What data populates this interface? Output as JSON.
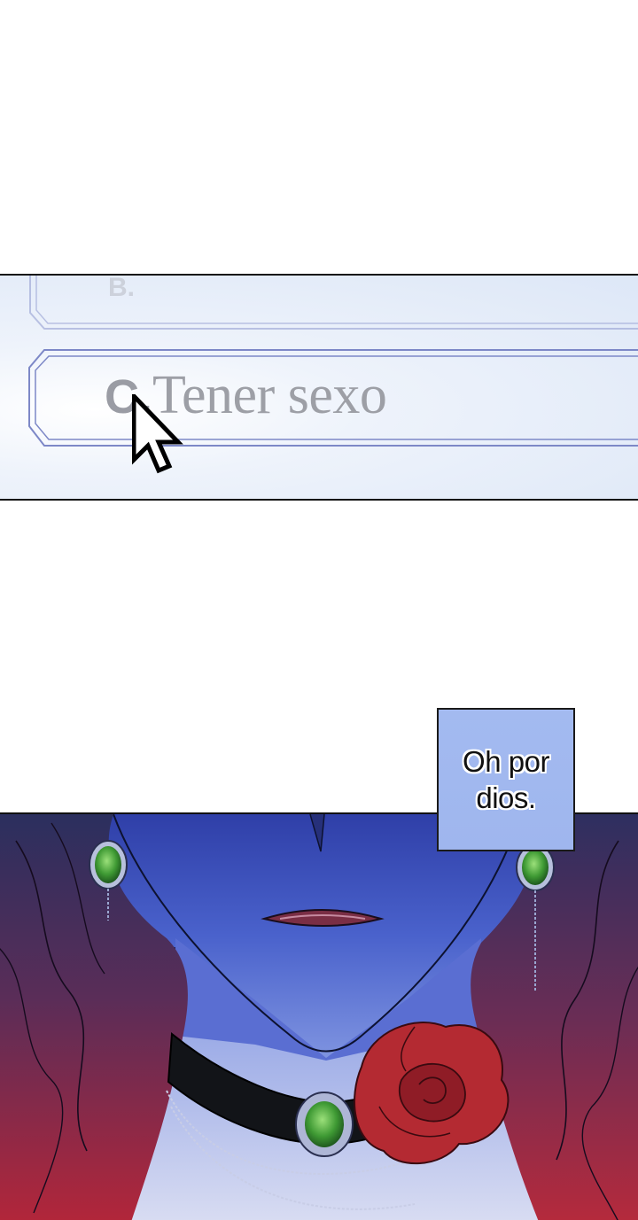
{
  "menu": {
    "option_b": {
      "letter": "B.",
      "text": ""
    },
    "option_c": {
      "letter": "C.",
      "text": "Tener sexo"
    }
  },
  "speech_bubble": {
    "text": "Oh por\ndios."
  },
  "icons": [
    "mouse-cursor-icon"
  ],
  "colors": {
    "menu_bg": "#e3ebf8",
    "option_border": "#7d88c7",
    "option_text": "#9d9fa6",
    "speech_box_bg": "#a3baf0",
    "skin_shadow": "#3b4fb0",
    "hair": "#8e2b40",
    "choker": "#121418",
    "rose": "#b42a32",
    "gem": "#4aa83a"
  }
}
